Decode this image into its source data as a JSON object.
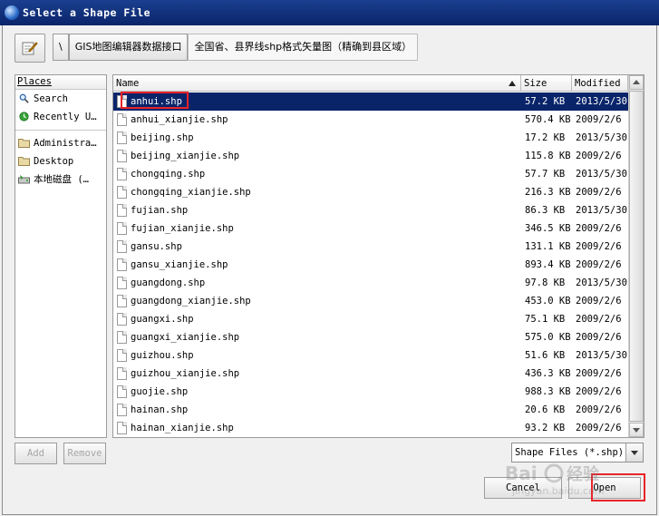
{
  "window": {
    "title": "Select a Shape File"
  },
  "path": {
    "root": "\\",
    "crumbs": [
      "GIS地图编辑器数据接口",
      "全国省、县界线shp格式矢量图（精确到县区域）"
    ]
  },
  "places": {
    "header": "Places",
    "items": [
      {
        "label": "Search",
        "icon": "search-icon"
      },
      {
        "label": "Recently U…",
        "icon": "recent-icon"
      },
      {
        "label": "Administra…",
        "icon": "folder-icon"
      },
      {
        "label": "Desktop",
        "icon": "folder-icon"
      },
      {
        "label": "本地磁盘 (…",
        "icon": "drive-icon"
      }
    ]
  },
  "files": {
    "columns": {
      "name": "Name",
      "size": "Size",
      "modified": "Modified"
    },
    "rows": [
      {
        "name": "anhui.shp",
        "size": "57.2 KB",
        "modified": "2013/5/30",
        "selected": true
      },
      {
        "name": "anhui_xianjie.shp",
        "size": "570.4 KB",
        "modified": "2009/2/6"
      },
      {
        "name": "beijing.shp",
        "size": "17.2 KB",
        "modified": "2013/5/30"
      },
      {
        "name": "beijing_xianjie.shp",
        "size": "115.8 KB",
        "modified": "2009/2/6"
      },
      {
        "name": "chongqing.shp",
        "size": "57.7 KB",
        "modified": "2013/5/30"
      },
      {
        "name": "chongqing_xianjie.shp",
        "size": "216.3 KB",
        "modified": "2009/2/6"
      },
      {
        "name": "fujian.shp",
        "size": "86.3 KB",
        "modified": "2013/5/30"
      },
      {
        "name": "fujian_xianjie.shp",
        "size": "346.5 KB",
        "modified": "2009/2/6"
      },
      {
        "name": "gansu.shp",
        "size": "131.1 KB",
        "modified": "2009/2/6"
      },
      {
        "name": "gansu_xianjie.shp",
        "size": "893.4 KB",
        "modified": "2009/2/6"
      },
      {
        "name": "guangdong.shp",
        "size": "97.8 KB",
        "modified": "2013/5/30"
      },
      {
        "name": "guangdong_xianjie.shp",
        "size": "453.0 KB",
        "modified": "2009/2/6"
      },
      {
        "name": "guangxi.shp",
        "size": "75.1 KB",
        "modified": "2009/2/6"
      },
      {
        "name": "guangxi_xianjie.shp",
        "size": "575.0 KB",
        "modified": "2009/2/6"
      },
      {
        "name": "guizhou.shp",
        "size": "51.6 KB",
        "modified": "2013/5/30"
      },
      {
        "name": "guizhou_xianjie.shp",
        "size": "436.3 KB",
        "modified": "2009/2/6"
      },
      {
        "name": "guojie.shp",
        "size": "988.3 KB",
        "modified": "2009/2/6"
      },
      {
        "name": "hainan.shp",
        "size": "20.6 KB",
        "modified": "2009/2/6"
      },
      {
        "name": "hainan_xianjie.shp",
        "size": "93.2 KB",
        "modified": "2009/2/6"
      }
    ]
  },
  "buttons": {
    "add": "Add",
    "remove": "Remove",
    "cancel": "Cancel",
    "open": "Open"
  },
  "filter": {
    "value": "Shape Files (*.shp)"
  },
  "colors": {
    "selection": "#0a246a",
    "highlight": "#e8242a"
  }
}
